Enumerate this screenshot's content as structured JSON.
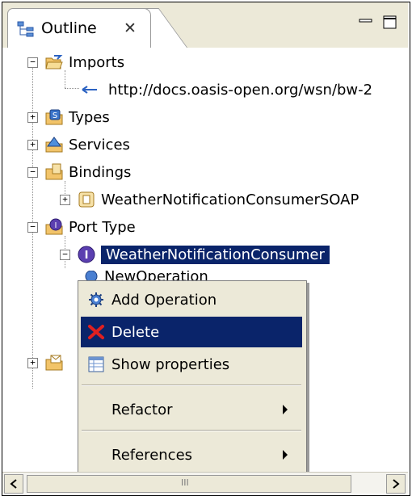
{
  "view": {
    "tab_label": "Outline",
    "tab_close": "✕"
  },
  "tree": {
    "imports_label": "Imports",
    "import_url": "http://docs.oasis-open.org/wsn/bw-2",
    "types_label": "Types",
    "services_label": "Services",
    "bindings_label": "Bindings",
    "binding_item": "WeatherNotificationConsumerSOAP",
    "port_type_label": "Port Type",
    "port_type_item": "WeatherNotificationConsumer",
    "partial_operation": "NewOperation"
  },
  "context_menu": {
    "items": [
      {
        "label": "Add Operation",
        "icon": "gear-icon"
      },
      {
        "label": "Delete",
        "icon": "delete-x-icon"
      },
      {
        "label": "Show properties",
        "icon": "properties-table-icon"
      },
      {
        "label": "Refactor",
        "submenu": true
      },
      {
        "label": "References",
        "submenu": true
      }
    ],
    "highlighted": "Delete"
  },
  "scrollbar": {
    "grip": "III"
  },
  "colors": {
    "selection": "#0a246a",
    "menu_bg": "#ece9d8",
    "folder": "#f2c46a"
  }
}
